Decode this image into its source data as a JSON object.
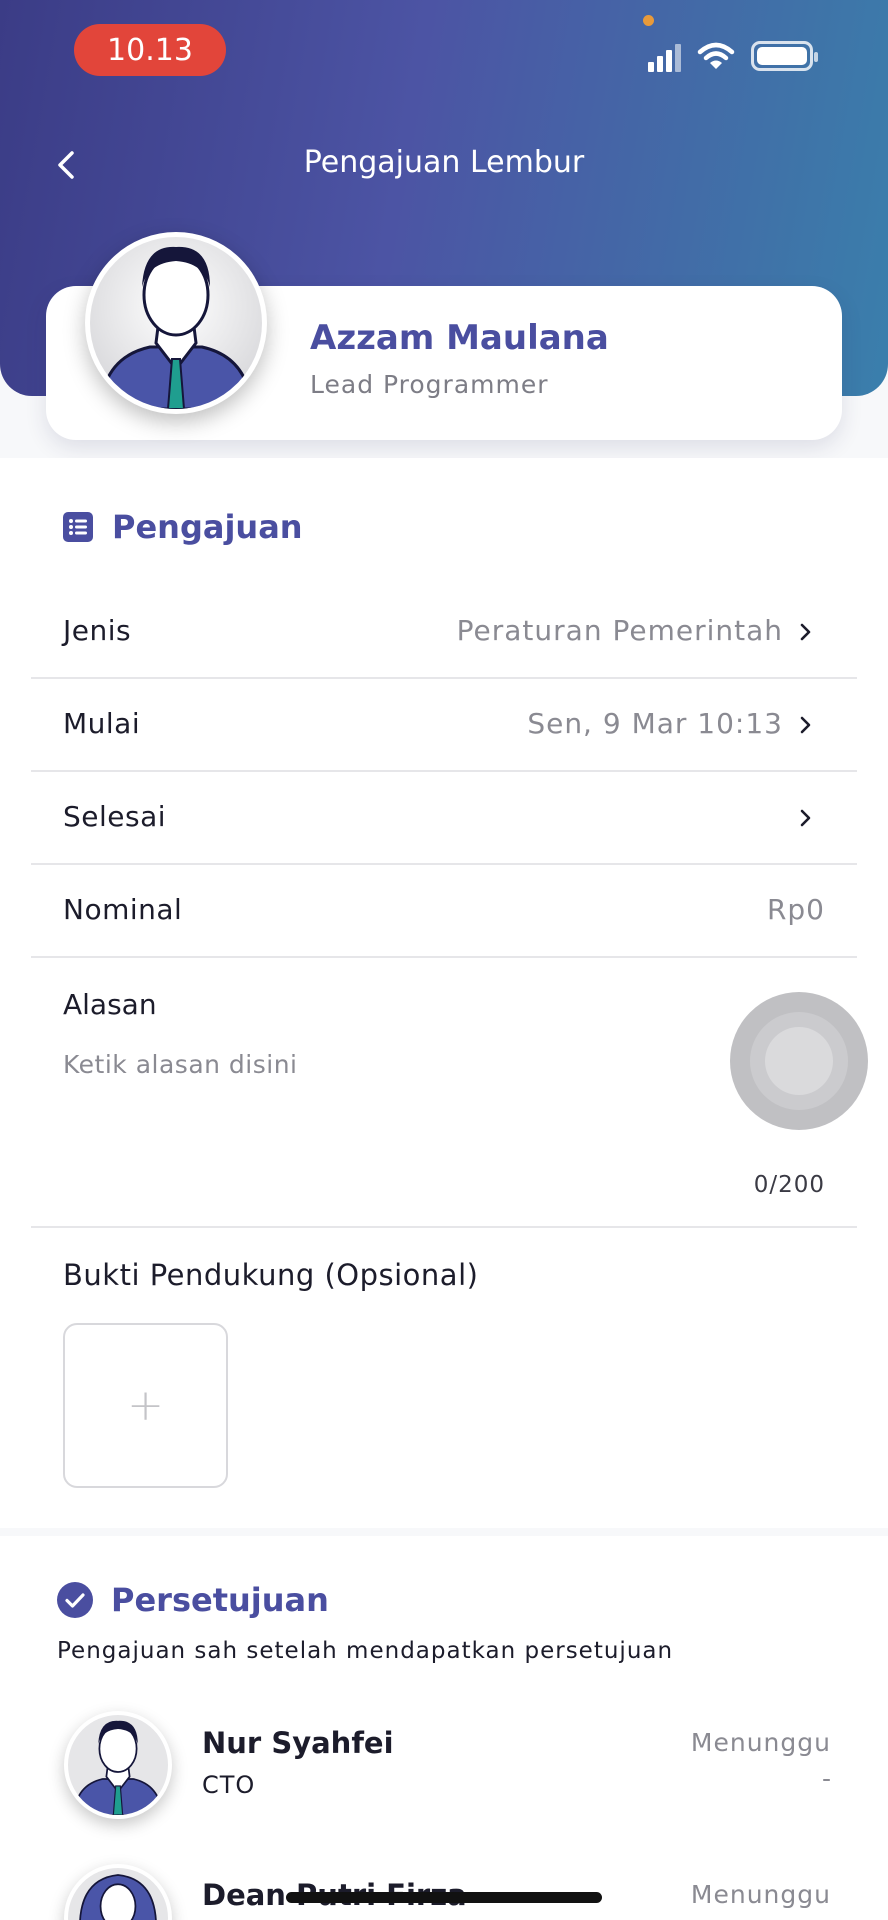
{
  "status_bar": {
    "time": "10.13",
    "icons": [
      "signal-icon",
      "wifi-icon",
      "battery-icon"
    ]
  },
  "header": {
    "title": "Pengajuan Lembur",
    "back_icon": "chevron-left-icon"
  },
  "profile": {
    "name": "Azzam Maulana",
    "role": "Lead Programmer"
  },
  "request_section": {
    "title": "Pengajuan",
    "icon": "list-icon",
    "rows": [
      {
        "label": "Jenis",
        "value": "Peraturan Pemerintah"
      },
      {
        "label": "Mulai",
        "value": "Sen, 9 Mar 10:13"
      },
      {
        "label": "Selesai",
        "value": ""
      },
      {
        "label": "Nominal",
        "value": "Rp0"
      }
    ],
    "reason": {
      "label": "Alasan",
      "placeholder": "Ketik alasan disini",
      "counter": "0/200"
    },
    "support": {
      "label": "Bukti Pendukung (Opsional)",
      "add_symbol": "+"
    }
  },
  "approval_section": {
    "title": "Persetujuan",
    "icon": "check-circle-icon",
    "subtitle": "Pengajuan sah setelah mendapatkan persetujuan",
    "approvers": [
      {
        "name": "Nur Syahfei",
        "role": "CTO",
        "status": "Menunggu",
        "date": "-"
      },
      {
        "name": "Dean Putri Firza",
        "role": "",
        "status": "Menunggu",
        "date": ""
      }
    ]
  },
  "colors": {
    "accent": "#4a4ea0",
    "header_gradient_start": "#3b3c86",
    "header_gradient_end": "#3a7fac",
    "time_pill": "#e2453a"
  }
}
